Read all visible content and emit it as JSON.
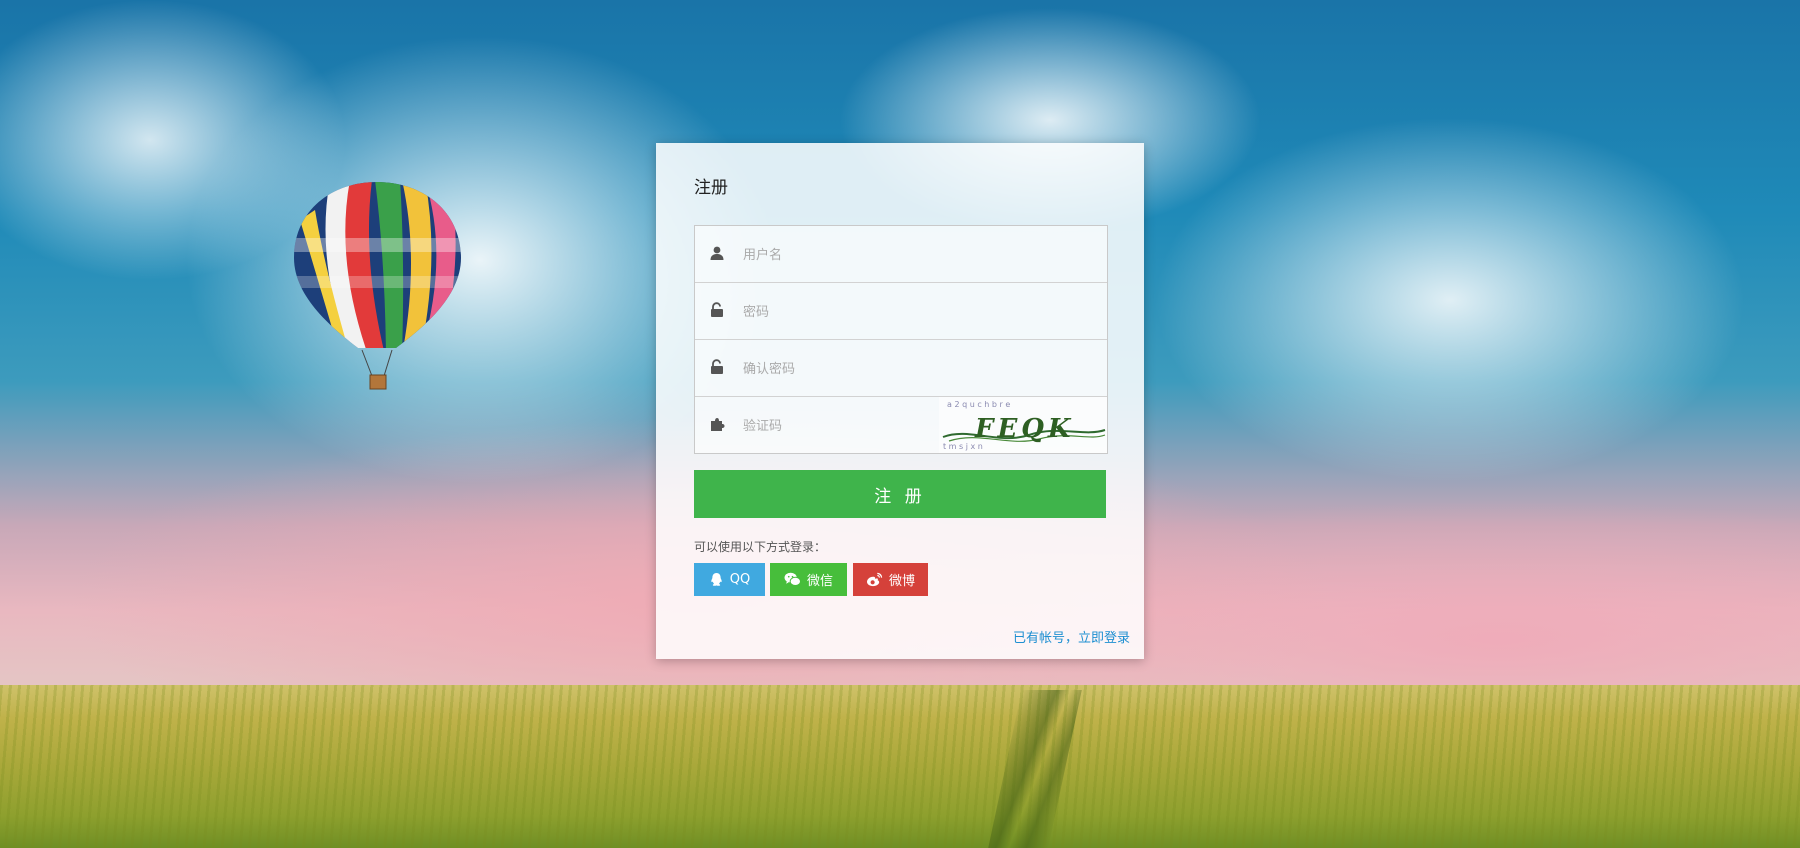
{
  "page": {
    "title": "注册"
  },
  "form": {
    "username_placeholder": "用户名",
    "password_placeholder": "密码",
    "confirm_placeholder": "确认密码",
    "captcha_placeholder": "验证码",
    "captcha_text": "FEQK"
  },
  "submit_label": "注 册",
  "alt_login": {
    "label": "可以使用以下方式登录：",
    "qq_label": "QQ",
    "wechat_label": "微信",
    "weibo_label": "微博"
  },
  "login_link": "已有帐号，立即登录",
  "icons": {
    "username": "user-icon",
    "password": "lock-open-icon",
    "confirm": "lock-open-icon",
    "captcha": "puzzle-icon",
    "qq": "qq-icon",
    "wechat": "wechat-icon",
    "weibo": "weibo-icon"
  },
  "colors": {
    "submit": "#3fb44b",
    "qq": "#40a9e0",
    "wechat": "#47be3b",
    "weibo": "#d5413a",
    "link": "#1e8fd1"
  }
}
